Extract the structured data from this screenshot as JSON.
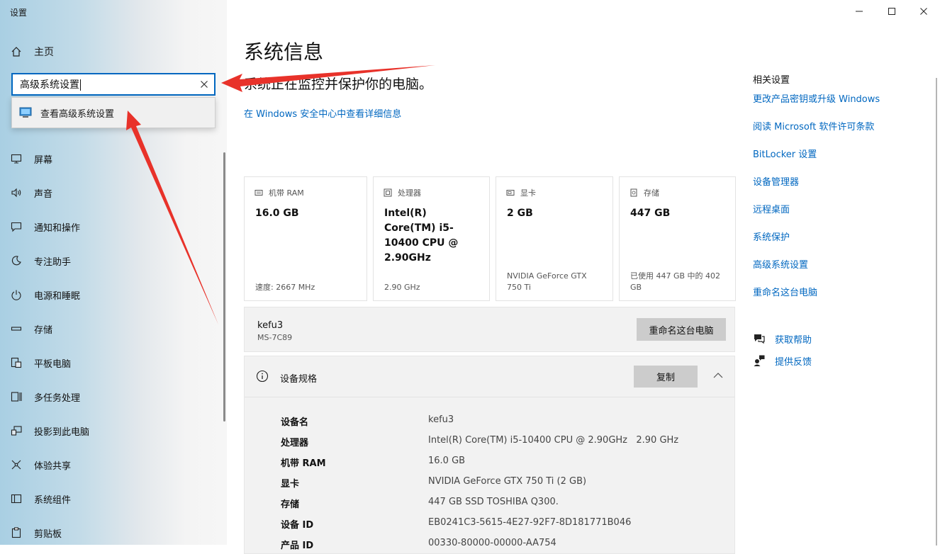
{
  "window": {
    "title": "设置",
    "controls": {
      "minimize_icon": "minimize-icon",
      "maximize_icon": "maximize-icon",
      "close_icon": "close-icon"
    }
  },
  "sidebar": {
    "home_label": "主页",
    "search": {
      "value": "高级系统设置",
      "clear_icon": "clear-icon"
    },
    "suggestion": {
      "label": "查看高级系统设置",
      "icon": "system-monitor-icon"
    },
    "items": [
      {
        "label": "屏幕",
        "icon": "display-icon"
      },
      {
        "label": "声音",
        "icon": "speaker-icon"
      },
      {
        "label": "通知和操作",
        "icon": "notification-icon"
      },
      {
        "label": "专注助手",
        "icon": "moon-icon"
      },
      {
        "label": "电源和睡眠",
        "icon": "power-icon"
      },
      {
        "label": "存储",
        "icon": "storage-icon"
      },
      {
        "label": "平板电脑",
        "icon": "tablet-icon"
      },
      {
        "label": "多任务处理",
        "icon": "multitask-icon"
      },
      {
        "label": "投影到此电脑",
        "icon": "project-icon"
      },
      {
        "label": "体验共享",
        "icon": "share-icon"
      },
      {
        "label": "系统组件",
        "icon": "components-icon"
      },
      {
        "label": "剪贴板",
        "icon": "clipboard-icon"
      }
    ]
  },
  "main": {
    "title": "系统信息",
    "subtitle": "系统正在监控并保护你的电脑。",
    "security_link": "在 Windows 安全中心中查看详细信息",
    "cards": [
      {
        "header": "机带 RAM",
        "icon": "ram-icon",
        "value": "16.0 GB",
        "sub": "速度: 2667 MHz"
      },
      {
        "header": "处理器",
        "icon": "cpu-icon",
        "value": "Intel(R) Core(TM) i5-10400 CPU @ 2.90GHz",
        "sub": "2.90 GHz"
      },
      {
        "header": "显卡",
        "icon": "gpu-icon",
        "value": "2 GB",
        "sub": "NVIDIA GeForce GTX 750 Ti"
      },
      {
        "header": "存储",
        "icon": "disk-icon",
        "value": "447 GB",
        "sub": "已使用 447 GB 中的 402 GB"
      }
    ],
    "device": {
      "name": "kefu3",
      "model": "MS-7C89",
      "rename_button": "重命名这台电脑"
    },
    "specs": {
      "title": "设备规格",
      "copy_button": "复制",
      "rows": [
        {
          "key": "设备名",
          "value": "kefu3"
        },
        {
          "key": "处理器",
          "value": "Intel(R) Core(TM) i5-10400 CPU @ 2.90GHz   2.90 GHz"
        },
        {
          "key": "机带 RAM",
          "value": "16.0 GB"
        },
        {
          "key": "显卡",
          "value": "NVIDIA GeForce GTX 750 Ti (2 GB)"
        },
        {
          "key": "存储",
          "value": "447 GB SSD TOSHIBA Q300."
        },
        {
          "key": "设备 ID",
          "value": "EB0241C3-5615-4E27-92F7-8D181771B046"
        },
        {
          "key": "产品 ID",
          "value": "00330-80000-00000-AA754"
        }
      ]
    }
  },
  "related": {
    "title": "相关设置",
    "links": [
      "更改产品密钥或升级 Windows",
      "阅读 Microsoft 软件许可条款",
      "BitLocker 设置",
      "设备管理器",
      "远程桌面",
      "系统保护",
      "高级系统设置",
      "重命名这台电脑"
    ],
    "help": {
      "label": "获取帮助",
      "icon": "help-chat-icon"
    },
    "feedback": {
      "label": "提供反馈",
      "icon": "feedback-icon"
    }
  },
  "annotation_color": "#e8322a"
}
